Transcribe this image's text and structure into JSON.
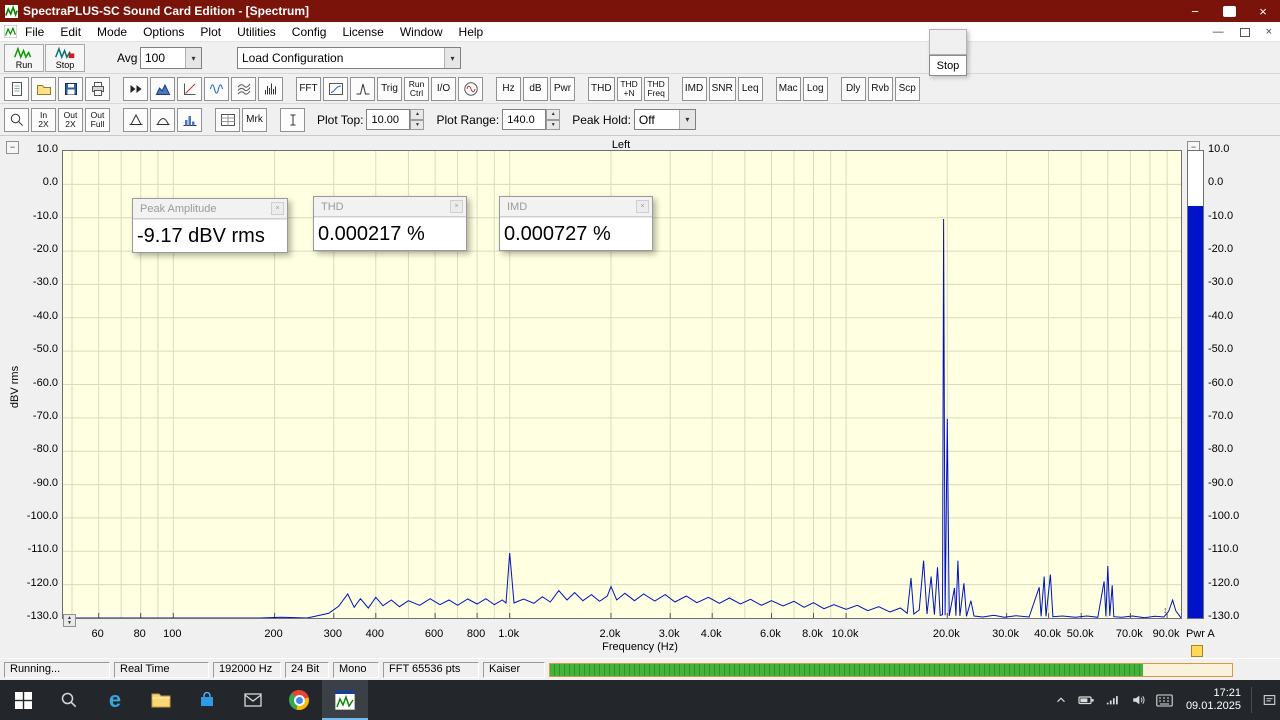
{
  "window": {
    "title": "SpectraPLUS-SC Sound Card Edition - [Spectrum]"
  },
  "menu": {
    "items": [
      "File",
      "Edit",
      "Mode",
      "Options",
      "Plot",
      "Utilities",
      "Config",
      "License",
      "Window",
      "Help"
    ]
  },
  "toolbar1": {
    "run": "Run",
    "stop": "Stop",
    "avg_label": "Avg",
    "avg_value": "100",
    "load_config": "Load Configuration"
  },
  "floating_stop": {
    "label": "Stop"
  },
  "toolbar2": {
    "buttons": [
      {
        "name": "new-file-button",
        "icon": "page"
      },
      {
        "name": "open-file-button",
        "icon": "folder"
      },
      {
        "name": "save-button",
        "icon": "floppy"
      },
      {
        "name": "print-button",
        "icon": "printer"
      },
      {
        "sep": true
      },
      {
        "name": "fast-forward-button",
        "icon": "ffwd"
      },
      {
        "name": "spectrum-view-button",
        "icon": "area"
      },
      {
        "name": "phase-view-button",
        "icon": "slope"
      },
      {
        "name": "time-series-button",
        "icon": "wave"
      },
      {
        "name": "waterfall-view-button",
        "icon": "waterfall"
      },
      {
        "name": "spectrogram-view-button",
        "icon": "comb"
      },
      {
        "sep": true
      },
      {
        "name": "fft-settings-button",
        "label": "FFT"
      },
      {
        "name": "transfer-function-button",
        "icon": "xfer"
      },
      {
        "name": "impulse-view-button",
        "icon": "spike"
      },
      {
        "name": "trigger-button",
        "label": "Trig"
      },
      {
        "name": "run-control-button",
        "lines": [
          "Run",
          "Ctrl"
        ]
      },
      {
        "name": "io-button",
        "label": "I/O"
      },
      {
        "name": "signal-generator-button",
        "icon": "sinecircle"
      },
      {
        "sep": true
      },
      {
        "name": "hz-units-button",
        "label": "Hz"
      },
      {
        "name": "db-units-button",
        "label": "dB"
      },
      {
        "name": "power-units-button",
        "label": "Pwr"
      },
      {
        "sep": true
      },
      {
        "name": "thd-button",
        "label": "THD"
      },
      {
        "name": "thd-n-button",
        "lines": [
          "THD",
          "+N"
        ]
      },
      {
        "name": "thd-freq-button",
        "lines": [
          "THD",
          "Freq"
        ]
      },
      {
        "sep": true
      },
      {
        "name": "imd-button",
        "label": "IMD"
      },
      {
        "name": "snr-button",
        "label": "SNR"
      },
      {
        "name": "leq-button",
        "label": "Leq"
      },
      {
        "sep": true
      },
      {
        "name": "macro-button",
        "label": "Mac"
      },
      {
        "name": "log-button",
        "label": "Log"
      },
      {
        "sep": true
      },
      {
        "name": "delay-button",
        "label": "Dly"
      },
      {
        "name": "reverb-button",
        "label": "Rvb"
      },
      {
        "name": "scope-button",
        "label": "Scp"
      }
    ]
  },
  "toolbar3": {
    "buttons": [
      {
        "name": "zoom-button",
        "icon": "magnifier"
      },
      {
        "name": "zoom-in-2x-button",
        "lines": [
          "In",
          "2X"
        ]
      },
      {
        "name": "zoom-out-2x-button",
        "lines": [
          "Out",
          "2X"
        ]
      },
      {
        "name": "zoom-out-full-button",
        "lines": [
          "Out",
          "Full"
        ]
      },
      {
        "sep": true
      },
      {
        "name": "peak-marker-button",
        "icon": "caret"
      },
      {
        "name": "curve-fit-button",
        "icon": "hump"
      },
      {
        "name": "histogram-button",
        "icon": "hist"
      },
      {
        "sep": true
      },
      {
        "name": "data-table-button",
        "icon": "table"
      },
      {
        "name": "marker-button",
        "label": "Mrk"
      },
      {
        "sep": true
      },
      {
        "name": "cursor-button",
        "icon": "ibeam"
      }
    ],
    "plot_top_label": "Plot Top:",
    "plot_top_value": "10.00",
    "plot_range_label": "Plot Range:",
    "plot_range_value": "140.0",
    "peak_hold_label": "Peak Hold:",
    "peak_hold_value": "Off"
  },
  "panels": [
    {
      "title": "Peak Amplitude",
      "value": "-9.17 dBV rms"
    },
    {
      "title": "THD",
      "value": "0.000217 %"
    },
    {
      "title": "IMD",
      "value": "0.000727 %"
    }
  ],
  "plot": {
    "title": "Left",
    "ylabel": "dBV rms",
    "xlabel": "Frequency (Hz)",
    "pwr_channel": "Pwr A"
  },
  "chart_data": {
    "type": "line",
    "title": "Left",
    "xlabel": "Frequency (Hz)",
    "ylabel": "dBV rms",
    "x_scale": "log",
    "xlim": [
      47,
      99000
    ],
    "ylim": [
      -130,
      10
    ],
    "y_tick_step": 10,
    "grid": true,
    "x_ticks": [
      {
        "f": 60,
        "l": "60"
      },
      {
        "f": 80,
        "l": "80"
      },
      {
        "f": 100,
        "l": "100"
      },
      {
        "f": 200,
        "l": "200"
      },
      {
        "f": 300,
        "l": "300"
      },
      {
        "f": 400,
        "l": "400"
      },
      {
        "f": 600,
        "l": "600"
      },
      {
        "f": 800,
        "l": "800"
      },
      {
        "f": 1000,
        "l": "1.0k"
      },
      {
        "f": 2000,
        "l": "2.0k"
      },
      {
        "f": 3000,
        "l": "3.0k"
      },
      {
        "f": 4000,
        "l": "4.0k"
      },
      {
        "f": 6000,
        "l": "6.0k"
      },
      {
        "f": 8000,
        "l": "8.0k"
      },
      {
        "f": 10000,
        "l": "10.0k"
      },
      {
        "f": 20000,
        "l": "20.0k"
      },
      {
        "f": 30000,
        "l": "30.0k"
      },
      {
        "f": 40000,
        "l": "40.0k"
      },
      {
        "f": 50000,
        "l": "50.0k"
      },
      {
        "f": 70000,
        "l": "70.0k"
      },
      {
        "f": 90000,
        "l": "90.0k"
      }
    ],
    "series": [
      {
        "name": "left-channel-spectrum",
        "points": [
          [
            47,
            -131
          ],
          [
            55,
            -130.4
          ],
          [
            65,
            -131
          ],
          [
            75,
            -130.2
          ],
          [
            90,
            -131
          ],
          [
            105,
            -130.3
          ],
          [
            125,
            -131
          ],
          [
            150,
            -130.2
          ],
          [
            180,
            -130.8
          ],
          [
            210,
            -129.8
          ],
          [
            250,
            -130.5
          ],
          [
            290,
            -128.6
          ],
          [
            310,
            -126.5
          ],
          [
            330,
            -122.8
          ],
          [
            345,
            -126.8
          ],
          [
            360,
            -124.2
          ],
          [
            380,
            -127
          ],
          [
            400,
            -123.8
          ],
          [
            420,
            -126.3
          ],
          [
            445,
            -124.6
          ],
          [
            470,
            -126.6
          ],
          [
            500,
            -124.8
          ],
          [
            540,
            -126.2
          ],
          [
            580,
            -124.2
          ],
          [
            620,
            -126
          ],
          [
            660,
            -124.6
          ],
          [
            700,
            -126.2
          ],
          [
            750,
            -124.3
          ],
          [
            800,
            -125.8
          ],
          [
            850,
            -124.2
          ],
          [
            900,
            -126
          ],
          [
            950,
            -124.6
          ],
          [
            975,
            -125.5
          ],
          [
            1000,
            -110.5
          ],
          [
            1030,
            -125.5
          ],
          [
            1100,
            -124.3
          ],
          [
            1180,
            -125.6
          ],
          [
            1250,
            -123.6
          ],
          [
            1320,
            -125.2
          ],
          [
            1400,
            -121.8
          ],
          [
            1480,
            -124.6
          ],
          [
            1560,
            -122.4
          ],
          [
            1650,
            -124.8
          ],
          [
            1750,
            -123
          ],
          [
            1850,
            -125
          ],
          [
            1950,
            -123.4
          ],
          [
            2000,
            -120.6
          ],
          [
            2080,
            -124.6
          ],
          [
            2200,
            -122.6
          ],
          [
            2350,
            -124.8
          ],
          [
            2500,
            -122.8
          ],
          [
            2700,
            -124.9
          ],
          [
            2900,
            -123
          ],
          [
            3100,
            -125.2
          ],
          [
            3350,
            -123.4
          ],
          [
            3600,
            -125.4
          ],
          [
            3900,
            -123.8
          ],
          [
            4200,
            -125.6
          ],
          [
            4500,
            -124
          ],
          [
            4850,
            -125.8
          ],
          [
            5200,
            -124.4
          ],
          [
            5600,
            -126.2
          ],
          [
            6000,
            -124.8
          ],
          [
            6500,
            -126.4
          ],
          [
            7000,
            -125
          ],
          [
            7500,
            -126.8
          ],
          [
            8000,
            -125.4
          ],
          [
            8600,
            -127.2
          ],
          [
            9200,
            -126
          ],
          [
            10000,
            -127.4
          ],
          [
            10800,
            -126.2
          ],
          [
            11600,
            -127.8
          ],
          [
            12500,
            -126.6
          ],
          [
            13500,
            -128.2
          ],
          [
            14500,
            -127
          ],
          [
            15200,
            -128.6
          ],
          [
            15600,
            -118
          ],
          [
            15900,
            -128.8
          ],
          [
            16500,
            -127.6
          ],
          [
            17000,
            -112.8
          ],
          [
            17400,
            -128.8
          ],
          [
            17900,
            -117.6
          ],
          [
            18300,
            -129
          ],
          [
            18700,
            -114.8
          ],
          [
            19050,
            -129.2
          ],
          [
            19350,
            -129
          ],
          [
            19500,
            -10.4
          ],
          [
            19700,
            -129.2
          ],
          [
            20000,
            -70.3
          ],
          [
            20250,
            -129.4
          ],
          [
            21000,
            -121
          ],
          [
            21200,
            -129.3
          ],
          [
            21500,
            -112.8
          ],
          [
            21800,
            -129.4
          ],
          [
            22400,
            -119.6
          ],
          [
            22800,
            -129.5
          ],
          [
            23500,
            -124.8
          ],
          [
            24000,
            -129.4
          ],
          [
            25500,
            -129.7
          ],
          [
            27500,
            -129.2
          ],
          [
            29500,
            -129.8
          ],
          [
            32000,
            -129.3
          ],
          [
            35000,
            -129.7
          ],
          [
            37500,
            -120.8
          ],
          [
            38000,
            -129.5
          ],
          [
            38800,
            -117.6
          ],
          [
            39300,
            -129.5
          ],
          [
            40500,
            -117
          ],
          [
            41200,
            -129.6
          ],
          [
            44000,
            -129.4
          ],
          [
            48000,
            -129.8
          ],
          [
            52000,
            -129.4
          ],
          [
            56000,
            -129.8
          ],
          [
            58500,
            -119
          ],
          [
            59200,
            -129.5
          ],
          [
            60000,
            -114.4
          ],
          [
            60800,
            -129.4
          ],
          [
            61800,
            -120.2
          ],
          [
            62500,
            -129.6
          ],
          [
            66000,
            -129.8
          ],
          [
            71000,
            -129.4
          ],
          [
            77000,
            -129.9
          ],
          [
            83000,
            -129.5
          ],
          [
            88000,
            -129.7
          ],
          [
            91000,
            -128
          ],
          [
            93500,
            -124.6
          ],
          [
            95500,
            -127.8
          ],
          [
            98000,
            -129.3
          ],
          [
            99000,
            -130
          ]
        ]
      }
    ],
    "level_meter": {
      "label": "Pwr A",
      "value_db": -6.5
    }
  },
  "statusbar": {
    "items": [
      "Running...",
      "Real Time",
      "192000 Hz",
      "24 Bit",
      "Mono",
      "FFT 65536 pts",
      "Kaiser"
    ],
    "progress_fraction": 0.87
  },
  "taskbar": {
    "time": "17:21",
    "date": "09.01.2025"
  }
}
